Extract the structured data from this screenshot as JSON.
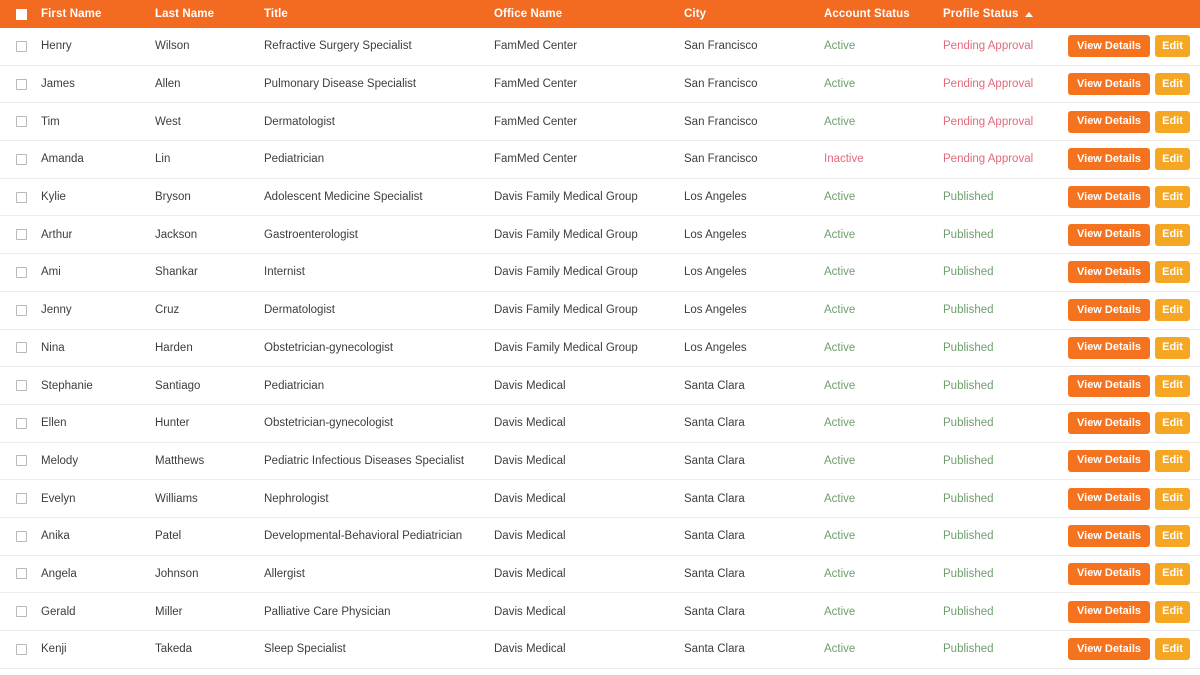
{
  "table": {
    "select_all_icon": "checkbox-checked-icon",
    "sort_indicator_icon": "sort-ascending-icon",
    "sorted_column": "Profile Status",
    "sort_direction": "ascending",
    "colors": {
      "header_background": "#F36A21",
      "header_text": "#FFFFFF",
      "row_text": "#3D3D3D",
      "row_divider": "#ECECEC",
      "status_positive": "#6E9E6E",
      "status_negative": "#E4697A",
      "view_details_button": "#F5731F",
      "edit_button": "#F5A623"
    },
    "columns": [
      {
        "key": "check",
        "label": ""
      },
      {
        "key": "first",
        "label": "First Name"
      },
      {
        "key": "last",
        "label": "Last Name"
      },
      {
        "key": "title",
        "label": "Title"
      },
      {
        "key": "office",
        "label": "Office Name"
      },
      {
        "key": "city",
        "label": "City"
      },
      {
        "key": "acct",
        "label": "Account Status"
      },
      {
        "key": "prof",
        "label": "Profile Status"
      },
      {
        "key": "act",
        "label": ""
      }
    ],
    "actions": {
      "view_details_label": "View Details",
      "edit_label": "Edit"
    },
    "rows": [
      {
        "first": "Henry",
        "last": "Wilson",
        "title": "Refractive Surgery Specialist",
        "office": "FamMed Center",
        "city": "San Francisco",
        "account_status": "Active",
        "account_status_state": "active",
        "profile_status": "Pending Approval",
        "profile_status_state": "pending"
      },
      {
        "first": "James",
        "last": "Allen",
        "title": "Pulmonary Disease Specialist",
        "office": "FamMed Center",
        "city": "San Francisco",
        "account_status": "Active",
        "account_status_state": "active",
        "profile_status": "Pending Approval",
        "profile_status_state": "pending"
      },
      {
        "first": "Tim",
        "last": "West",
        "title": "Dermatologist",
        "office": "FamMed Center",
        "city": "San Francisco",
        "account_status": "Active",
        "account_status_state": "active",
        "profile_status": "Pending Approval",
        "profile_status_state": "pending"
      },
      {
        "first": "Amanda",
        "last": "Lin",
        "title": "Pediatrician",
        "office": "FamMed Center",
        "city": "San Francisco",
        "account_status": "Inactive",
        "account_status_state": "inactive",
        "profile_status": "Pending Approval",
        "profile_status_state": "pending"
      },
      {
        "first": "Kylie",
        "last": "Bryson",
        "title": "Adolescent Medicine Specialist",
        "office": "Davis Family Medical Group",
        "city": "Los Angeles",
        "account_status": "Active",
        "account_status_state": "active",
        "profile_status": "Published",
        "profile_status_state": "published"
      },
      {
        "first": "Arthur",
        "last": "Jackson",
        "title": "Gastroenterologist",
        "office": "Davis Family Medical Group",
        "city": "Los Angeles",
        "account_status": "Active",
        "account_status_state": "active",
        "profile_status": "Published",
        "profile_status_state": "published"
      },
      {
        "first": "Ami",
        "last": "Shankar",
        "title": "Internist",
        "office": "Davis Family Medical Group",
        "city": "Los Angeles",
        "account_status": "Active",
        "account_status_state": "active",
        "profile_status": "Published",
        "profile_status_state": "published"
      },
      {
        "first": "Jenny",
        "last": "Cruz",
        "title": "Dermatologist",
        "office": "Davis Family Medical Group",
        "city": "Los Angeles",
        "account_status": "Active",
        "account_status_state": "active",
        "profile_status": "Published",
        "profile_status_state": "published"
      },
      {
        "first": "Nina",
        "last": "Harden",
        "title": "Obstetrician-gynecologist",
        "office": "Davis Family Medical Group",
        "city": "Los Angeles",
        "account_status": "Active",
        "account_status_state": "active",
        "profile_status": "Published",
        "profile_status_state": "published"
      },
      {
        "first": "Stephanie",
        "last": "Santiago",
        "title": "Pediatrician",
        "office": "Davis Medical",
        "city": "Santa Clara",
        "account_status": "Active",
        "account_status_state": "active",
        "profile_status": "Published",
        "profile_status_state": "published"
      },
      {
        "first": "Ellen",
        "last": "Hunter",
        "title": "Obstetrician-gynecologist",
        "office": "Davis Medical",
        "city": "Santa Clara",
        "account_status": "Active",
        "account_status_state": "active",
        "profile_status": "Published",
        "profile_status_state": "published"
      },
      {
        "first": "Melody",
        "last": "Matthews",
        "title": "Pediatric Infectious Diseases Specialist",
        "office": "Davis Medical",
        "city": "Santa Clara",
        "account_status": "Active",
        "account_status_state": "active",
        "profile_status": "Published",
        "profile_status_state": "published"
      },
      {
        "first": "Evelyn",
        "last": "Williams",
        "title": "Nephrologist",
        "office": "Davis Medical",
        "city": "Santa Clara",
        "account_status": "Active",
        "account_status_state": "active",
        "profile_status": "Published",
        "profile_status_state": "published"
      },
      {
        "first": "Anika",
        "last": "Patel",
        "title": "Developmental-Behavioral Pediatrician",
        "office": "Davis Medical",
        "city": "Santa Clara",
        "account_status": "Active",
        "account_status_state": "active",
        "profile_status": "Published",
        "profile_status_state": "published"
      },
      {
        "first": "Angela",
        "last": "Johnson",
        "title": "Allergist",
        "office": "Davis Medical",
        "city": "Santa Clara",
        "account_status": "Active",
        "account_status_state": "active",
        "profile_status": "Published",
        "profile_status_state": "published"
      },
      {
        "first": "Gerald",
        "last": "Miller",
        "title": "Palliative Care Physician",
        "office": "Davis Medical",
        "city": "Santa Clara",
        "account_status": "Active",
        "account_status_state": "active",
        "profile_status": "Published",
        "profile_status_state": "published"
      },
      {
        "first": "Kenji",
        "last": "Takeda",
        "title": "Sleep Specialist",
        "office": "Davis Medical",
        "city": "Santa Clara",
        "account_status": "Active",
        "account_status_state": "active",
        "profile_status": "Published",
        "profile_status_state": "published"
      }
    ]
  }
}
